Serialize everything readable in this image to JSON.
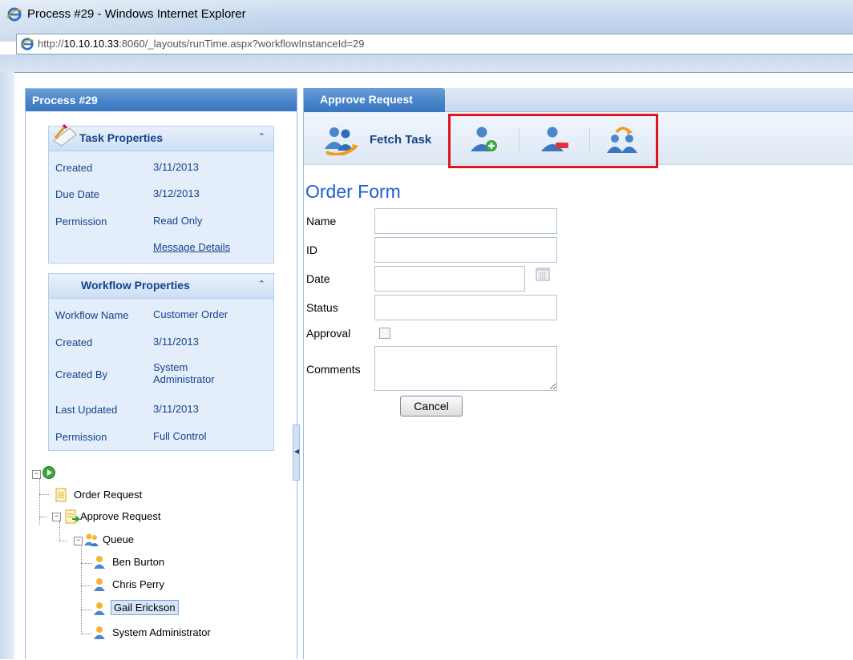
{
  "window": {
    "title": "Process #29 - Windows Internet Explorer",
    "url_prefix": "http://",
    "url_host": "10.10.10.33",
    "url_rest": ":8060/_layouts/runTime.aspx?workflowInstanceId=29"
  },
  "left_panel": {
    "title": "Process #29",
    "task_properties": {
      "heading": "Task Properties",
      "rows": [
        {
          "label": "Created",
          "value": "3/11/2013"
        },
        {
          "label": "Due Date",
          "value": "3/12/2013"
        },
        {
          "label": "Permission",
          "value": "Read Only"
        }
      ],
      "link": "Message Details"
    },
    "workflow_properties": {
      "heading": "Workflow Properties",
      "rows": [
        {
          "label": "Workflow Name",
          "value": "Customer Order"
        },
        {
          "label": "Created",
          "value": "3/11/2013"
        },
        {
          "label": "Created By",
          "value_line1": "System",
          "value_line2": "Administrator"
        },
        {
          "label": "Last Updated",
          "value": "3/11/2013"
        },
        {
          "label": "Permission",
          "value": "Full Control"
        }
      ]
    },
    "tree": {
      "order_request": "Order Request",
      "approve_request": "Approve Request",
      "queue": "Queue",
      "users": [
        "Ben Burton",
        "Chris Perry",
        "Gail Erickson",
        "System Administrator"
      ],
      "selected_user": "Gail Erickson"
    }
  },
  "right_panel": {
    "tab": "Approve Request",
    "toolbar": {
      "fetch_task": "Fetch Task",
      "icons": [
        "add-user-icon",
        "remove-user-icon",
        "reassign-users-icon"
      ]
    },
    "form": {
      "title": "Order Form",
      "fields": {
        "name": "Name",
        "id": "ID",
        "date": "Date",
        "status": "Status",
        "approval": "Approval",
        "comments": "Comments"
      },
      "values": {
        "name": "",
        "id": "",
        "date": "",
        "status": "",
        "comments": ""
      },
      "approval_checked": false,
      "cancel": "Cancel"
    }
  },
  "colors": {
    "header_blue": "#4a86cb",
    "label_blue": "#15428b",
    "form_title": "#1f5fd6",
    "highlight_red": "#e0141e"
  }
}
